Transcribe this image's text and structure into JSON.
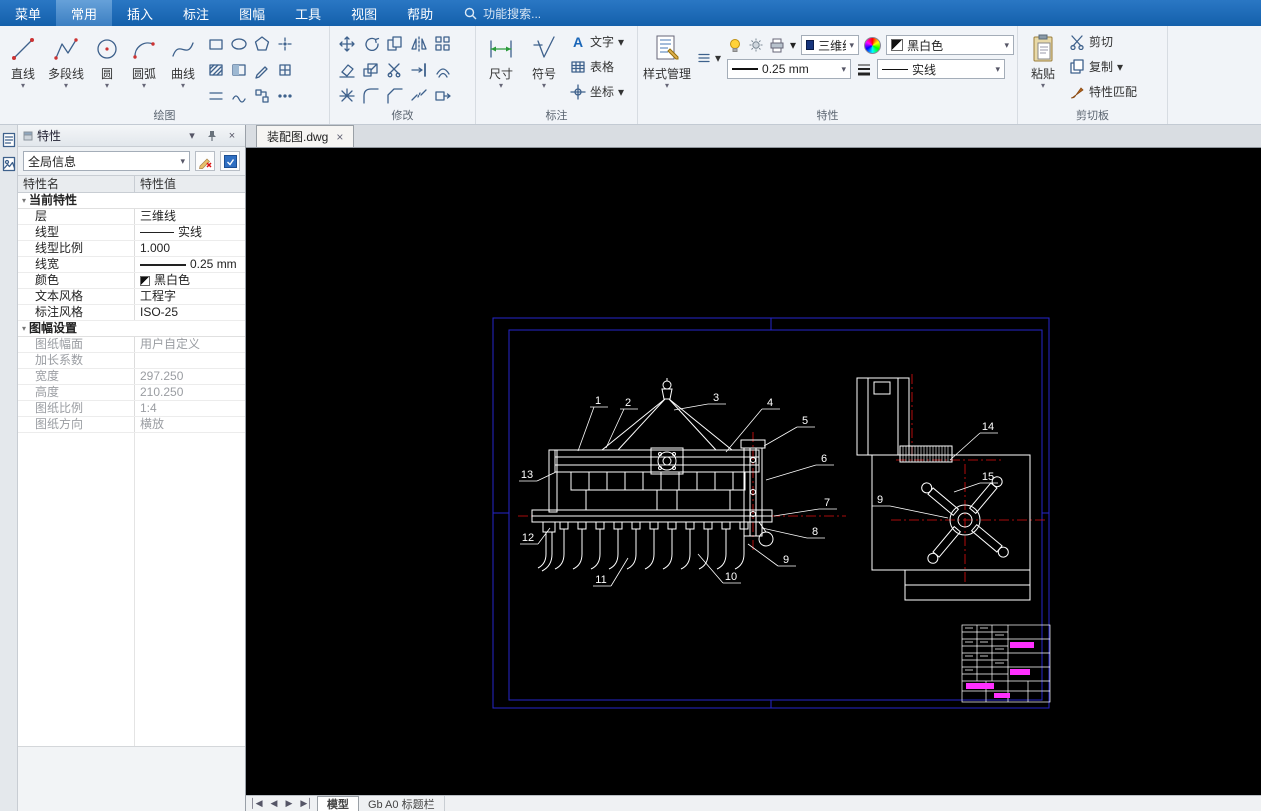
{
  "menubar": {
    "items": [
      {
        "label": "菜单"
      },
      {
        "label": "常用"
      },
      {
        "label": "插入"
      },
      {
        "label": "标注"
      },
      {
        "label": "图幅"
      },
      {
        "label": "工具"
      },
      {
        "label": "视图"
      },
      {
        "label": "帮助"
      }
    ],
    "active": "常用",
    "search_placeholder": "功能搜索..."
  },
  "ribbon": {
    "draw": {
      "label": "绘图",
      "tools": [
        {
          "label": "直线"
        },
        {
          "label": "多段线"
        },
        {
          "label": "圆"
        },
        {
          "label": "圆弧"
        },
        {
          "label": "曲线"
        }
      ]
    },
    "modify": {
      "label": "修改"
    },
    "annotate": {
      "label": "标注",
      "dimension": "尺寸",
      "symbol": "符号",
      "text": "文字",
      "table": "表格",
      "coord": "坐标"
    },
    "props": {
      "label": "特性",
      "style_manager": "样式管理",
      "layer": "三维线",
      "color": "黑白色",
      "lineweight": "0.25 mm",
      "linetype": "实线"
    },
    "clipboard": {
      "label": "剪切板",
      "paste": "粘贴",
      "cut": "剪切",
      "copy": "复制",
      "match": "特性匹配"
    }
  },
  "panel": {
    "title": "特性",
    "scope": "全局信息",
    "col_name": "特性名",
    "col_value": "特性值",
    "group1": {
      "label": "当前特性",
      "rows": [
        {
          "name": "层",
          "value": "三维线"
        },
        {
          "name": "线型",
          "value": "实线"
        },
        {
          "name": "线型比例",
          "value": "1.000"
        },
        {
          "name": "线宽",
          "value": "0.25 mm"
        },
        {
          "name": "颜色",
          "value": "黑白色"
        },
        {
          "name": "文本风格",
          "value": "工程字"
        },
        {
          "name": "标注风格",
          "value": "ISO-25"
        }
      ]
    },
    "group2": {
      "label": "图幅设置",
      "rows": [
        {
          "name": "图纸幅面",
          "value": "用户自定义"
        },
        {
          "name": "加长系数",
          "value": ""
        },
        {
          "name": "宽度",
          "value": "297.250"
        },
        {
          "name": "高度",
          "value": "210.250"
        },
        {
          "name": "图纸比例",
          "value": "1:4"
        },
        {
          "name": "图纸方向",
          "value": "横放"
        }
      ]
    }
  },
  "document": {
    "tab": "装配图.dwg"
  },
  "canvas": {
    "callouts": [
      "1",
      "2",
      "3",
      "4",
      "5",
      "6",
      "7",
      "8",
      "9",
      "10",
      "11",
      "12",
      "13",
      "14",
      "15"
    ]
  },
  "bottom": {
    "tabs": [
      {
        "label": "模型",
        "active": true
      },
      {
        "label": "Gb A0 标题栏",
        "active": false
      }
    ]
  }
}
